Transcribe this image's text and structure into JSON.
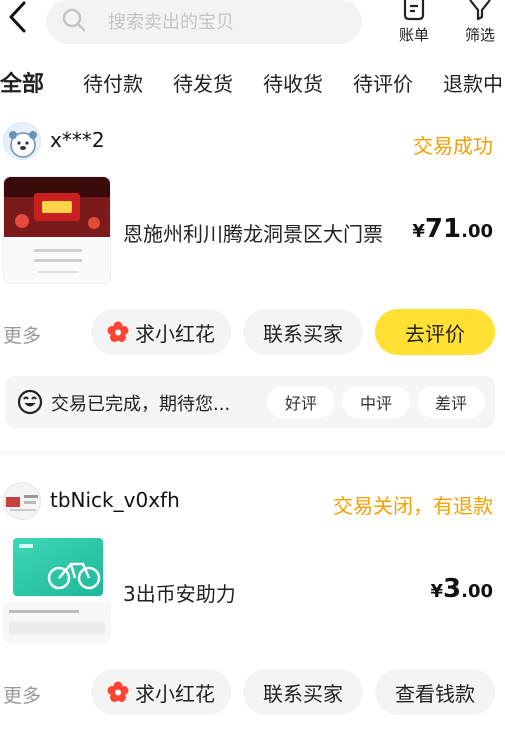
{
  "search": {
    "placeholder": "搜索卖出的宝贝"
  },
  "tools": {
    "bill_label": "账单",
    "filter_label": "筛选"
  },
  "tabs": [
    {
      "label": "全部"
    },
    {
      "label": "待付款"
    },
    {
      "label": "待发货"
    },
    {
      "label": "待收货"
    },
    {
      "label": "待评价"
    },
    {
      "label": "退款中"
    }
  ],
  "orders": [
    {
      "buyer": "x***2",
      "status": "交易成功",
      "title": "恩施州利川腾龙洞景区大门票",
      "price": {
        "currency": "¥",
        "integer": "71",
        "decimal": ".00"
      },
      "more_label": "更多",
      "buttons": {
        "flower": "求小红花",
        "contact": "联系买家",
        "action": "去评价"
      },
      "review": {
        "text": "交易已完成，期待您...",
        "good": "好评",
        "neutral": "中评",
        "bad": "差评"
      }
    },
    {
      "buyer": "tbNick_v0xfh",
      "status": "交易关闭，有退款",
      "title": "3出币安助力",
      "price": {
        "currency": "¥",
        "integer": "3",
        "decimal": ".00"
      },
      "more_label": "更多",
      "buttons": {
        "flower": "求小红花",
        "contact": "联系买家",
        "action": "查看钱款"
      }
    }
  ],
  "colors": {
    "accent_yellow": "#ffe033",
    "status_orange": "#f5a000",
    "flower_red": "#ff4433"
  }
}
